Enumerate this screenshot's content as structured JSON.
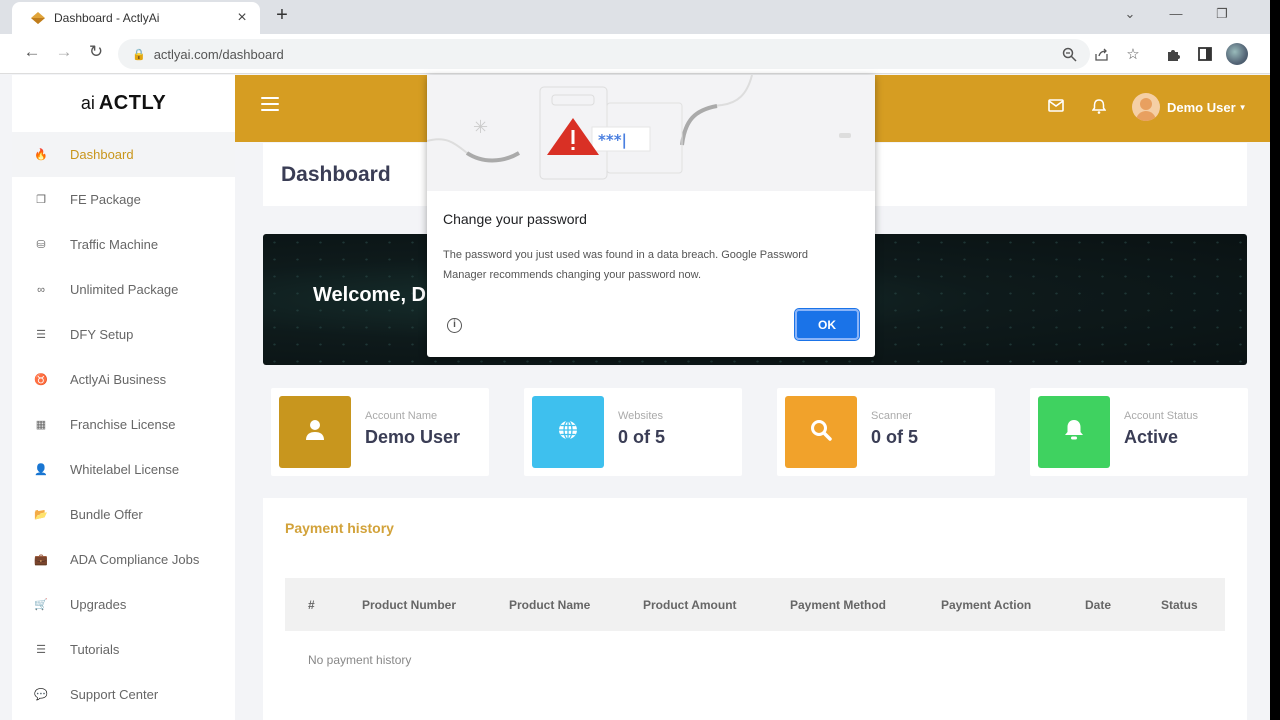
{
  "browser": {
    "tab_title": "Dashboard - ActlyAi",
    "close_tab": "×",
    "new_tab": "+",
    "url": "actlyai.com/dashboard",
    "window_controls": {
      "tabsearch": "⌄",
      "minimize": "—",
      "restore": "❐"
    }
  },
  "sidebar": {
    "logo_prefix": "ai",
    "logo_brand": "ACTLY",
    "items": [
      {
        "label": "Dashboard",
        "icon": "fire-icon",
        "glyph": "🔥",
        "active": true
      },
      {
        "label": "FE Package",
        "icon": "clone-icon",
        "glyph": "❐"
      },
      {
        "label": "Traffic Machine",
        "icon": "database-icon",
        "glyph": "⛁"
      },
      {
        "label": "Unlimited Package",
        "icon": "infinity-icon",
        "glyph": "∞"
      },
      {
        "label": "DFY Setup",
        "icon": "list-check-icon",
        "glyph": "☰"
      },
      {
        "label": "ActlyAi Business",
        "icon": "taurus-icon",
        "glyph": "♉"
      },
      {
        "label": "Franchise License",
        "icon": "building-icon",
        "glyph": "▦"
      },
      {
        "label": "Whitelabel License",
        "icon": "user-tag-icon",
        "glyph": "👤"
      },
      {
        "label": "Bundle Offer",
        "icon": "folder-open-icon",
        "glyph": "📂"
      },
      {
        "label": "ADA Compliance Jobs",
        "icon": "briefcase-icon",
        "glyph": "💼"
      },
      {
        "label": "Upgrades",
        "icon": "cart-icon",
        "glyph": "🛒"
      },
      {
        "label": "Tutorials",
        "icon": "database-stack-icon",
        "glyph": "☰"
      },
      {
        "label": "Support Center",
        "icon": "comments-icon",
        "glyph": "💬"
      }
    ]
  },
  "topbar": {
    "user_name": "Demo User",
    "caret": "▼"
  },
  "page_title": "Dashboard",
  "banner": {
    "welcome": "Welcome, D"
  },
  "stats": [
    {
      "label": "Account Name",
      "value": "Demo User",
      "icon": "user-icon",
      "color": "#c8961e"
    },
    {
      "label": "Websites",
      "value": "0 of 5",
      "icon": "globe-icon",
      "color": "#3ec0ee"
    },
    {
      "label": "Scanner",
      "value": "0 of 5",
      "icon": "search-icon",
      "color": "#f1a22b"
    },
    {
      "label": "Account Status",
      "value": "Active",
      "icon": "bell-icon",
      "color": "#3fd260"
    }
  ],
  "payment_history": {
    "title": "Payment history",
    "columns": [
      "#",
      "Product Number",
      "Product Name",
      "Product Amount",
      "Payment Method",
      "Payment Action",
      "Date",
      "Status"
    ],
    "empty_text": "No payment history"
  },
  "dialog": {
    "title": "Change your password",
    "body": "The password you just used was found in a data breach. Google Password Manager recommends changing your password now.",
    "ok_label": "OK",
    "info_glyph": "i",
    "password_mask": "***|"
  },
  "colors": {
    "brand": "#d69d22",
    "active_nav": "#c9961c",
    "ok_button": "#1a73e8",
    "warning": "#d93025"
  }
}
